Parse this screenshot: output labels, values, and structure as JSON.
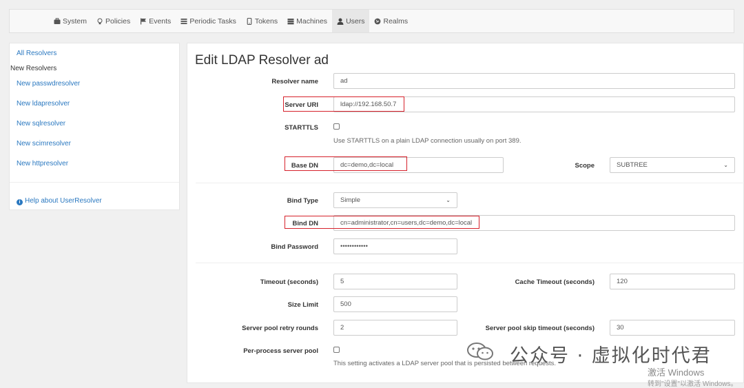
{
  "nav": {
    "items": [
      {
        "label": "System",
        "icon": "briefcase-icon"
      },
      {
        "label": "Policies",
        "icon": "lightbulb-icon"
      },
      {
        "label": "Events",
        "icon": "flag-icon"
      },
      {
        "label": "Periodic Tasks",
        "icon": "tasks-icon"
      },
      {
        "label": "Tokens",
        "icon": "phone-icon"
      },
      {
        "label": "Machines",
        "icon": "server-icon"
      },
      {
        "label": "Users",
        "icon": "user-icon"
      },
      {
        "label": "Realms",
        "icon": "globe-icon"
      }
    ],
    "active": "Users"
  },
  "sidebar": {
    "all_resolvers": "All Resolvers",
    "new_heading": "New Resolvers",
    "links": [
      "New passwdresolver",
      "New ldapresolver",
      "New sqlresolver",
      "New scimresolver",
      "New httpresolver"
    ],
    "help": "Help about UserResolver"
  },
  "form": {
    "title": "Edit LDAP Resolver ad",
    "resolver_name": {
      "label": "Resolver name",
      "value": "ad"
    },
    "server_uri": {
      "label": "Server URI",
      "value": "ldap://192.168.50.7"
    },
    "starttls": {
      "label": "STARTTLS",
      "help": "Use STARTTLS on a plain LDAP connection usually on port 389."
    },
    "base_dn": {
      "label": "Base DN",
      "value": "dc=demo,dc=local"
    },
    "scope": {
      "label": "Scope",
      "value": "SUBTREE"
    },
    "bind_type": {
      "label": "Bind Type",
      "value": "Simple"
    },
    "bind_dn": {
      "label": "Bind DN",
      "value": "cn=administrator,cn=users,dc=demo,dc=local"
    },
    "bind_password": {
      "label": "Bind Password",
      "value": "••••••••••••"
    },
    "timeout": {
      "label": "Timeout (seconds)",
      "value": "5"
    },
    "cache_timeout": {
      "label": "Cache Timeout (seconds)",
      "value": "120"
    },
    "size_limit": {
      "label": "Size Limit",
      "value": "500"
    },
    "pool_retry": {
      "label": "Server pool retry rounds",
      "value": "2"
    },
    "pool_skip": {
      "label": "Server pool skip timeout (seconds)",
      "value": "30"
    },
    "per_process": {
      "label": "Per-process server pool",
      "help": "This setting activates a LDAP server pool that is persisted between requests."
    }
  },
  "watermark": {
    "text": "公众号 · 虚拟化时代君",
    "win_line1": "激活 Windows",
    "win_line2": "转到\"设置\"以激活 Windows。"
  },
  "colors": {
    "link": "#2a78c0",
    "highlight": "#d6202a"
  }
}
